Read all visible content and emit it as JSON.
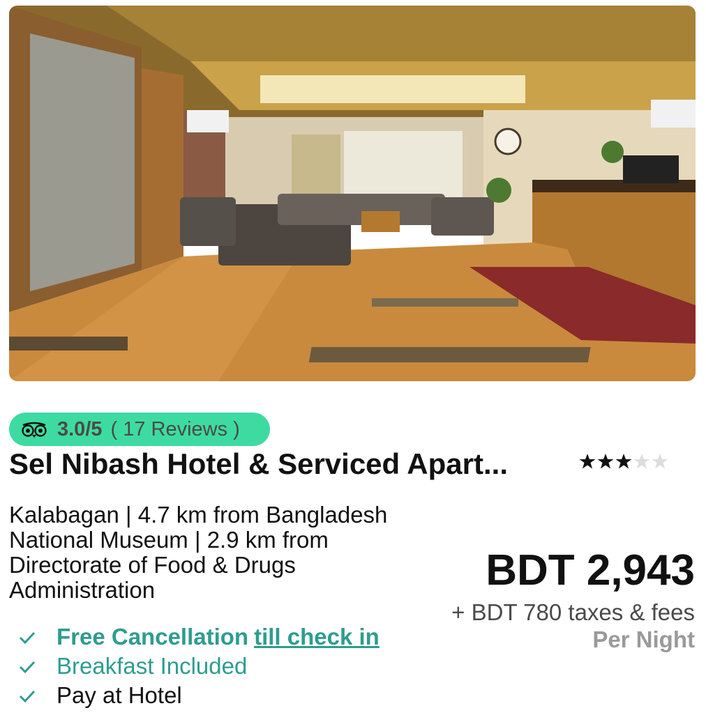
{
  "rating": {
    "score": "3.0/5",
    "reviews": "( 17 Reviews )",
    "icon": "tripadvisor-icon"
  },
  "hotel": {
    "name": "Sel Nibash Hotel & Serviced Apart...",
    "stars": 3,
    "stars_max": 5,
    "location": "Kalabagan | 4.7 km from Bangladesh National Museum | 2.9 km from Directorate of Food & Drugs Administration"
  },
  "features": {
    "cancellation": "Free Cancellation",
    "cancellation_link": "till check in",
    "breakfast": "Breakfast Included",
    "pay": "Pay at Hotel"
  },
  "pricing": {
    "price": "BDT 2,943",
    "taxes": "+ BDT 780 taxes & fees",
    "per_night": "Per Night"
  },
  "colors": {
    "accent": "#3ddba2",
    "feature_text": "#2e9c8f",
    "muted": "#9a9a9a"
  }
}
